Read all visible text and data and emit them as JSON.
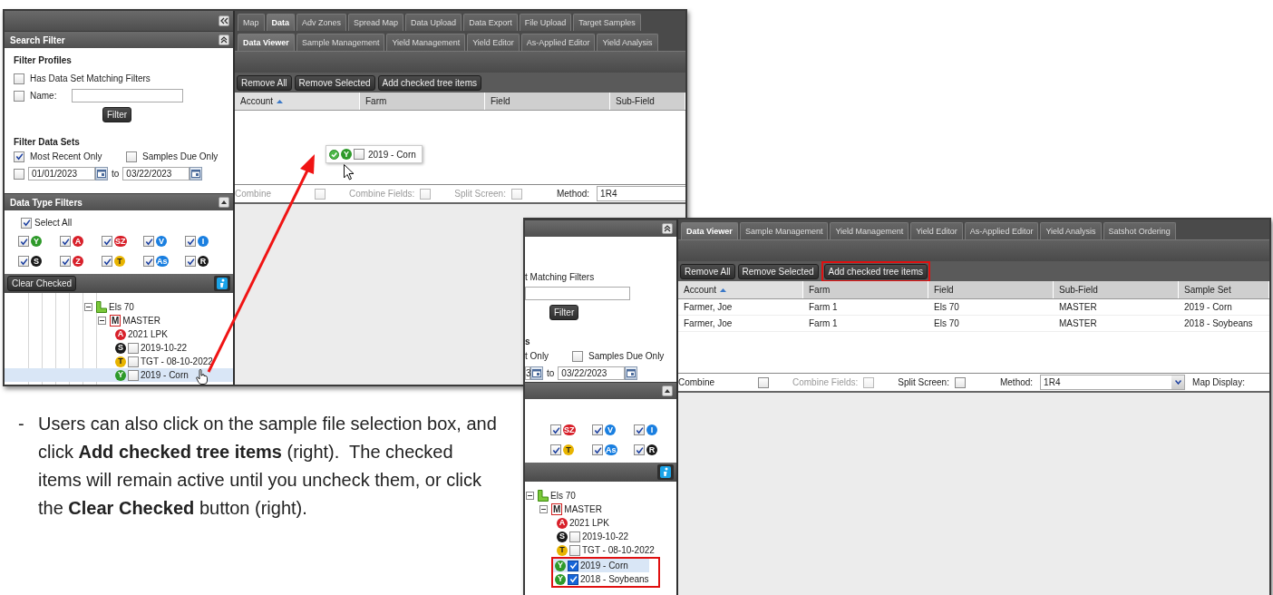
{
  "screenshots": [
    {
      "kind": "full",
      "main_tabs": [
        {
          "label": "Map",
          "selected": false
        },
        {
          "label": "Data",
          "selected": true
        },
        {
          "label": "Adv Zones",
          "selected": false
        },
        {
          "label": "Spread Map",
          "selected": false
        },
        {
          "label": "Data Upload",
          "selected": false
        },
        {
          "label": "Data Export",
          "selected": false
        },
        {
          "label": "File Upload",
          "selected": false
        },
        {
          "label": "Target Samples",
          "selected": false
        }
      ],
      "sub_tabs": [
        {
          "label": "Data Viewer",
          "selected": true
        },
        {
          "label": "Sample Management",
          "selected": false
        },
        {
          "label": "Yield Management",
          "selected": false
        },
        {
          "label": "Yield Editor",
          "selected": false
        },
        {
          "label": "As-Applied Editor",
          "selected": false
        },
        {
          "label": "Yield Analysis",
          "selected": false
        }
      ],
      "sidebar": {
        "search_filter_title": "Search Filter",
        "profiles_heading": "Filter Profiles",
        "has_matching": {
          "label": "Has Data Set Matching Filters",
          "checked": false
        },
        "name_filter": {
          "label": "Name:",
          "checked": false
        },
        "filter_button": "Filter",
        "data_sets_heading": "Filter Data Sets",
        "most_recent": {
          "label": "Most Recent Only",
          "checked": true
        },
        "samples_due": {
          "label": "Samples Due Only",
          "checked": false
        },
        "date_range": {
          "checked": false,
          "from": "01/01/2023",
          "to_label": "to",
          "to": "03/22/2023"
        },
        "data_type_title": "Data Type Filters",
        "select_all": {
          "label": "Select All",
          "checked": true
        },
        "data_types": [
          {
            "letter": "Y",
            "color": "#2e9a2a",
            "checked": true
          },
          {
            "letter": "A",
            "color": "#d8202a",
            "checked": true
          },
          {
            "letter": "SZ",
            "color": "#d8202a",
            "checked": true
          },
          {
            "letter": "V",
            "color": "#1a7fe0",
            "checked": true
          },
          {
            "letter": "I",
            "color": "#1a7fe0",
            "checked": true
          },
          {
            "letter": "S",
            "color": "#1a1a1a",
            "checked": true
          },
          {
            "letter": "Z",
            "color": "#d8202a",
            "checked": true
          },
          {
            "letter": "T",
            "color": "#e8b400",
            "checked": true
          },
          {
            "letter": "As",
            "color": "#1a7fe0",
            "checked": true
          },
          {
            "letter": "R",
            "color": "#1a1a1a",
            "checked": true
          }
        ],
        "clear_checked_button": "Clear Checked",
        "tree": [
          {
            "kind": "field",
            "label": "Els 70",
            "expanded": true,
            "children": [
              {
                "kind": "subfield",
                "letter": "M",
                "label": "MASTER",
                "expanded": true,
                "children": [
                  {
                    "kind": "layer",
                    "letter": "A",
                    "color": "#d8202a",
                    "label": "2021 LPK",
                    "selected": false,
                    "highlighted": false
                  },
                  {
                    "kind": "sample",
                    "letter": "S",
                    "color": "#1a1a1a",
                    "label": "2019-10-22",
                    "checked": false,
                    "selected": false,
                    "highlighted": false
                  },
                  {
                    "kind": "sample",
                    "letter": "T",
                    "color": "#e8b400",
                    "label": "TGT - 08-10-2022",
                    "checked": false,
                    "selected": false,
                    "highlighted": false
                  },
                  {
                    "kind": "sample",
                    "letter": "Y",
                    "color": "#2e9a2a",
                    "label": "2019 - Corn",
                    "checked": false,
                    "selected": true,
                    "highlighted": false
                  }
                ]
              }
            ]
          }
        ]
      },
      "toolbar_buttons": [
        {
          "label": "Remove All",
          "highlighted": false
        },
        {
          "label": "Remove Selected",
          "highlighted": false
        },
        {
          "label": "Add checked tree items",
          "highlighted": false
        }
      ],
      "columns": [
        {
          "label": "Account",
          "sorted": true
        },
        {
          "label": "Farm",
          "sorted": false
        },
        {
          "label": "Field",
          "sorted": false
        },
        {
          "label": "Sub-Field",
          "sorted": false
        }
      ],
      "drag_ghost": {
        "letter": "Y",
        "color": "#2e9a2a",
        "checked": false,
        "label": "2019 - Corn"
      },
      "options": [
        {
          "kind": "checkbox",
          "label": "Combine",
          "checked": false,
          "disabled": true
        },
        {
          "kind": "checkbox",
          "label": "Combine Fields:",
          "checked": false,
          "disabled": true
        },
        {
          "kind": "checkbox",
          "label": "Split Screen:",
          "checked": false,
          "disabled": true
        },
        {
          "kind": "select",
          "label": "Method:",
          "value": "1R4"
        }
      ]
    },
    {
      "kind": "cropped",
      "sub_tabs": [
        {
          "label": "Data Viewer",
          "selected": true
        },
        {
          "label": "Sample Management",
          "selected": false
        },
        {
          "label": "Yield Management",
          "selected": false
        },
        {
          "label": "Yield Editor",
          "selected": false
        },
        {
          "label": "As-Applied Editor",
          "selected": false
        },
        {
          "label": "Yield Analysis",
          "selected": false
        },
        {
          "label": "Satshot Ordering",
          "selected": false
        }
      ],
      "sidebar": {
        "has_matching": {
          "label": "t Matching Filters"
        },
        "filter_button": "Filter",
        "data_sets_heading": "s",
        "most_recent": {
          "label": "t Only"
        },
        "samples_due": {
          "label": "Samples Due Only",
          "checked": false
        },
        "date_range": {
          "from": "3",
          "to_label": "to",
          "to": "03/22/2023"
        },
        "data_types": [
          {
            "letter": "SZ",
            "color": "#d8202a",
            "checked": true
          },
          {
            "letter": "V",
            "color": "#1a7fe0",
            "checked": true
          },
          {
            "letter": "I",
            "color": "#1a7fe0",
            "checked": true
          },
          {
            "letter": "T",
            "color": "#e8b400",
            "checked": true
          },
          {
            "letter": "As",
            "color": "#1a7fe0",
            "checked": true
          },
          {
            "letter": "R",
            "color": "#1a1a1a",
            "checked": true
          }
        ],
        "tree": [
          {
            "kind": "field",
            "label": "Els 70",
            "expanded": true,
            "children": [
              {
                "kind": "subfield",
                "letter": "M",
                "label": "MASTER",
                "expanded": true,
                "children": [
                  {
                    "kind": "layer",
                    "letter": "A",
                    "color": "#d8202a",
                    "label": "2021 LPK",
                    "selected": false,
                    "highlighted": false
                  },
                  {
                    "kind": "sample",
                    "letter": "S",
                    "color": "#1a1a1a",
                    "label": "2019-10-22",
                    "checked": false,
                    "selected": false,
                    "highlighted": false
                  },
                  {
                    "kind": "sample",
                    "letter": "T",
                    "color": "#e8b400",
                    "label": "TGT - 08-10-2022",
                    "checked": false,
                    "selected": false,
                    "highlighted": false
                  },
                  {
                    "kind": "sample",
                    "letter": "Y",
                    "color": "#2e9a2a",
                    "label": "2019 - Corn",
                    "checked": true,
                    "selected": true,
                    "highlighted": true
                  },
                  {
                    "kind": "sample",
                    "letter": "Y",
                    "color": "#2e9a2a",
                    "label": "2018 - Soybeans",
                    "checked": true,
                    "selected": false,
                    "highlighted": true
                  }
                ]
              }
            ]
          }
        ]
      },
      "toolbar_buttons": [
        {
          "label": "Remove All",
          "highlighted": false
        },
        {
          "label": "Remove Selected",
          "highlighted": false
        },
        {
          "label": "Add checked tree items",
          "highlighted": true
        }
      ],
      "columns": [
        {
          "label": "Account",
          "sorted": true
        },
        {
          "label": "Farm",
          "sorted": false
        },
        {
          "label": "Field",
          "sorted": false
        },
        {
          "label": "Sub-Field",
          "sorted": false
        },
        {
          "label": "Sample Set",
          "sorted": false
        }
      ],
      "rows": [
        [
          "Farmer, Joe",
          "Farm 1",
          "Els 70",
          "MASTER",
          "2019 - Corn"
        ],
        [
          "Farmer, Joe",
          "Farm 1",
          "Els 70",
          "MASTER",
          "2018 - Soybeans"
        ]
      ],
      "options": [
        {
          "kind": "checkbox",
          "label": "Combine",
          "checked": false,
          "disabled": false
        },
        {
          "kind": "checkbox",
          "label": "Combine Fields:",
          "checked": false,
          "disabled": true
        },
        {
          "kind": "checkbox",
          "label": "Split Screen:",
          "checked": false,
          "disabled": false
        },
        {
          "kind": "select",
          "label": "Method:",
          "value": "1R4",
          "dropdown_button": true
        },
        {
          "kind": "label",
          "label": "Map Display:"
        }
      ]
    }
  ],
  "note": {
    "bullet": "-",
    "text": "Users can also click on the sample file selection box, and click **Add checked tree items** (right).  The checked items will remain active until you uncheck them, or click the **Clear Checked** button (right)."
  }
}
